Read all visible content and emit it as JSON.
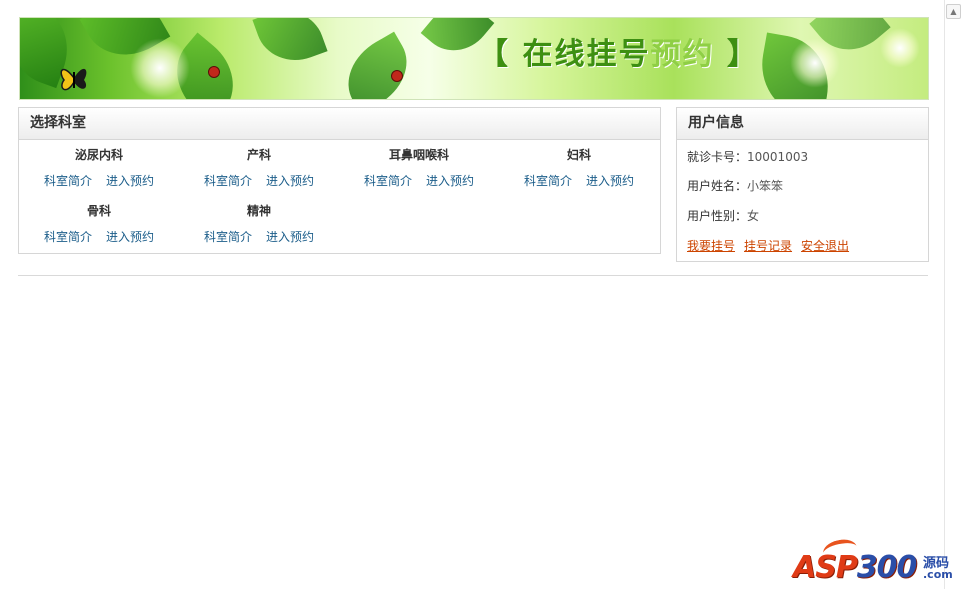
{
  "banner": {
    "title_main": "【 在线挂号",
    "title_muted": "预约",
    "title_end": " 】"
  },
  "dept_panel": {
    "title": "选择科室",
    "departments": [
      {
        "name": "泌尿内科",
        "intro": "科室简介",
        "book": "进入预约"
      },
      {
        "name": "产科",
        "intro": "科室简介",
        "book": "进入预约"
      },
      {
        "name": "耳鼻咽喉科",
        "intro": "科室简介",
        "book": "进入预约"
      },
      {
        "name": "妇科",
        "intro": "科室简介",
        "book": "进入预约"
      },
      {
        "name": "骨科",
        "intro": "科室简介",
        "book": "进入预约"
      },
      {
        "name": "精神",
        "intro": "科室简介",
        "book": "进入预约"
      }
    ]
  },
  "user_panel": {
    "title": "用户信息",
    "card_label": "就诊卡号：",
    "card_value": "10001003",
    "name_label": "用户姓名：",
    "name_value": "小笨笨",
    "gender_label": "用户性别：",
    "gender_value": "女",
    "links": {
      "register": "我要挂号",
      "records": "挂号记录",
      "logout": "安全退出"
    }
  },
  "watermark": {
    "brand_a": "ASP",
    "brand_b": "300",
    "sub1": "源码",
    "sub2": ".com"
  },
  "colors": {
    "link": "#1b5d8a",
    "user_link": "#cc4400",
    "banner_green": "#3d8f12"
  }
}
